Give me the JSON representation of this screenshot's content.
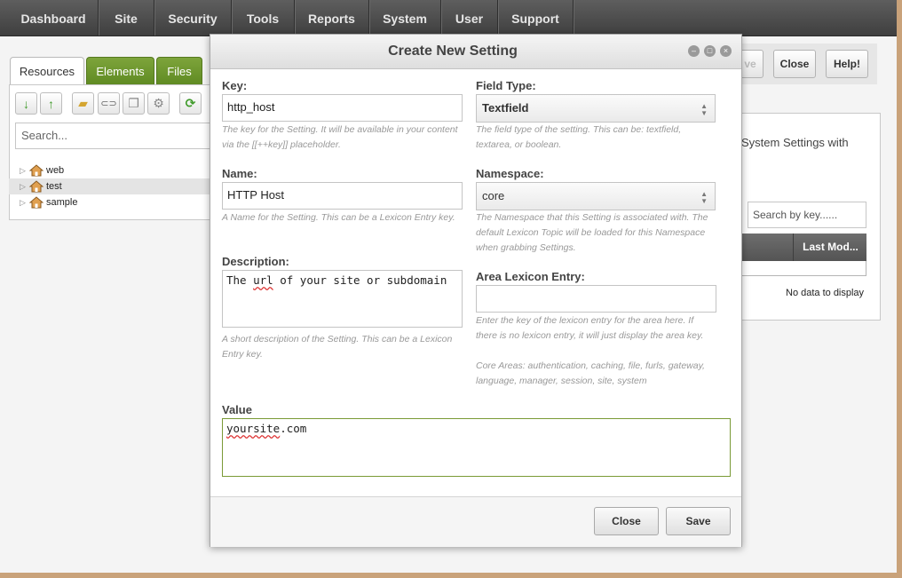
{
  "nav": [
    "Dashboard",
    "Site",
    "Security",
    "Tools",
    "Reports",
    "System",
    "User",
    "Support"
  ],
  "left": {
    "tabs": [
      "Resources",
      "Elements",
      "Files"
    ],
    "search_placeholder": "Search...",
    "tree": [
      "web",
      "test",
      "sample"
    ]
  },
  "right": {
    "save_label": "ve",
    "close_label": "Close",
    "help_label": "Help!",
    "desc": "System Settings with",
    "search_placeholder": "Search by key......",
    "col_last_modified": "Last Mod...",
    "no_data": "No data to display"
  },
  "modal": {
    "title": "Create New Setting",
    "key_label": "Key:",
    "key_value": "http_host",
    "key_help": "The key for the Setting. It will be available in your content via the [[++key]] placeholder.",
    "field_type_label": "Field Type:",
    "field_type_value": "Textfield",
    "field_type_help": "The field type of the setting. This can be: textfield, textarea, or boolean.",
    "name_label": "Name:",
    "name_value": "HTTP Host",
    "name_help": "A Name for the Setting. This can be a Lexicon Entry key.",
    "namespace_label": "Namespace:",
    "namespace_value": "core",
    "namespace_help": "The Namespace that this Setting is associated with. The default Lexicon Topic will be loaded for this Namespace when grabbing Settings.",
    "description_label": "Description:",
    "description_value_pre": "The ",
    "description_value_sq": "url",
    "description_value_post": " of your site or subdomain",
    "description_help": "A short description of the Setting. This can be a Lexicon Entry key.",
    "area_label": "Area Lexicon Entry:",
    "area_value": "",
    "area_help": "Enter the key of the lexicon entry for the area here. If there is no lexicon entry, it will just display the area key.",
    "area_help2": "Core Areas: authentication, caching, file, furls, gateway, language, manager, session, site, system",
    "value_label": "Value",
    "value_value_sq": "yoursite",
    "value_value_post": ".com",
    "close_button": "Close",
    "save_button": "Save"
  },
  "colors": {
    "accent_green": "#6b9530",
    "nav_bg": "#4a4a4a",
    "frame": "#c9a27a"
  }
}
